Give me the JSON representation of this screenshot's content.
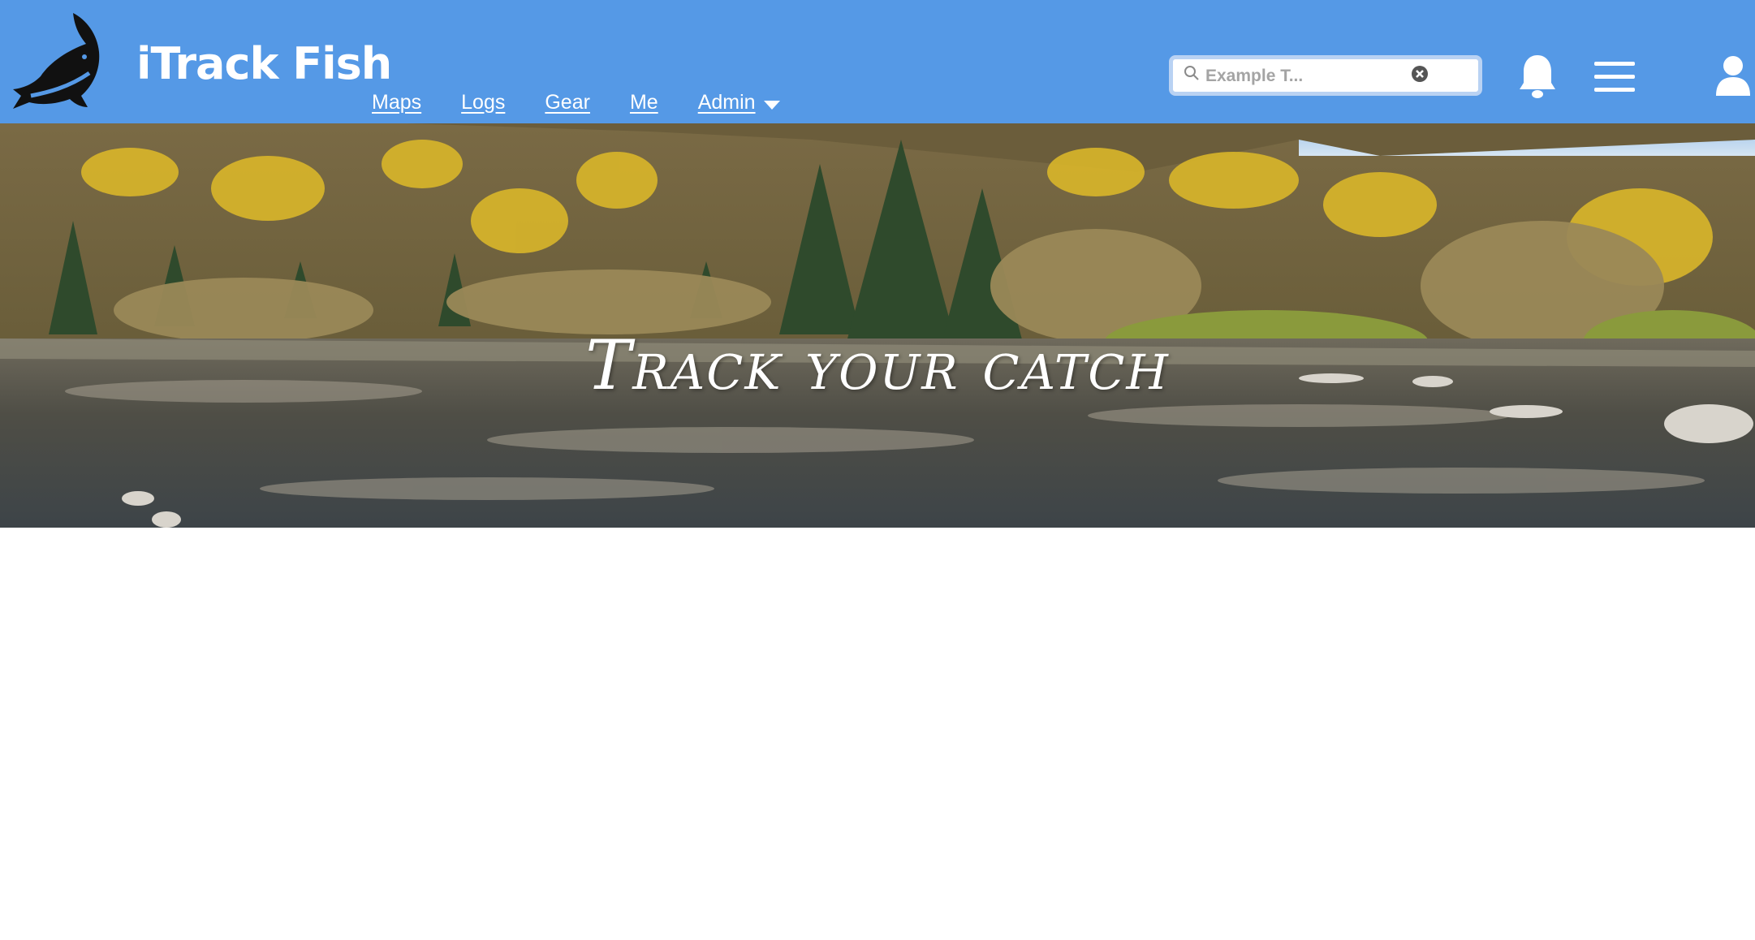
{
  "app": {
    "title": "iTrack Fish",
    "logo_icon": "fish-logo-icon"
  },
  "nav": {
    "items": [
      {
        "label": "Maps"
      },
      {
        "label": "Logs"
      },
      {
        "label": "Gear"
      },
      {
        "label": "Me"
      },
      {
        "label": "Admin",
        "has_dropdown": true
      }
    ]
  },
  "search": {
    "placeholder": "Example T...",
    "value": "",
    "icon": "search-icon",
    "clear_icon": "clear-icon"
  },
  "header_icons": {
    "notifications": "bell-icon",
    "menu": "hamburger-menu-icon",
    "account": "user-icon"
  },
  "hero": {
    "tagline": "Track your catch",
    "image": "river-landscape-image"
  },
  "colors": {
    "header_bg": "#5599e6",
    "header_text": "#ffffff",
    "search_border": "#b9d2f3",
    "page_bg": "#ffffff"
  }
}
